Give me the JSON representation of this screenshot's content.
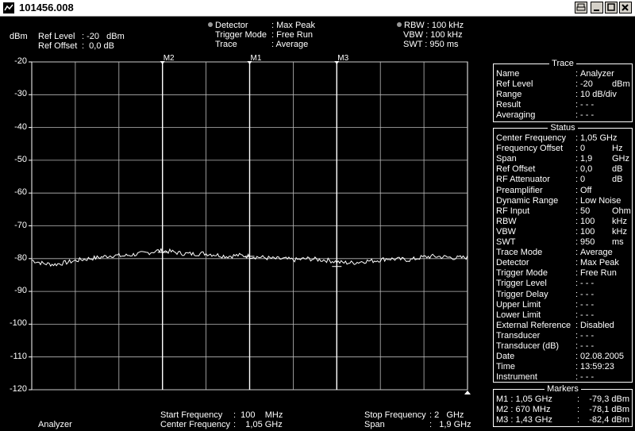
{
  "window": {
    "title": "101456.008"
  },
  "header": {
    "unit": "dBm",
    "ref_level_label": "Ref Level",
    "ref_level_value": ": -20   dBm",
    "ref_offset_label": "Ref Offset",
    "ref_offset_value": ":  0,0 dB",
    "detector_label": "Detector",
    "detector_value": ": Max Peak",
    "trigger_label": "Trigger Mode",
    "trigger_value": ": Free Run",
    "trace_label": "Trace",
    "trace_value": ": Average",
    "rbw": "RBW : 100 kHz",
    "vbw": "VBW : 100 kHz",
    "swt": "SWT : 950 ms"
  },
  "markers_top": [
    "M2",
    "M1",
    "M3"
  ],
  "trace_panel": {
    "title": "Trace",
    "rows": [
      {
        "k": "Name",
        "v": "Analyzer",
        "u": ""
      },
      {
        "k": "Ref Level",
        "v": "-20",
        "u": "dBm"
      },
      {
        "k": "Range",
        "v": "10 dB/div",
        "u": ""
      },
      {
        "k": "Result",
        "v": "- - -",
        "u": ""
      },
      {
        "k": "Averaging",
        "v": "- - -",
        "u": ""
      }
    ]
  },
  "status_panel": {
    "title": "Status",
    "rows": [
      {
        "k": "Center Frequency",
        "v": "1,05 GHz",
        "u": ""
      },
      {
        "k": "Frequency Offset",
        "v": "0",
        "u": "Hz"
      },
      {
        "k": "Span",
        "v": "1,9",
        "u": "GHz"
      },
      {
        "k": "Ref Offset",
        "v": "0,0",
        "u": "dB"
      },
      {
        "k": "RF Attenuator",
        "v": "0",
        "u": "dB"
      },
      {
        "k": "Preamplifier",
        "v": "Off",
        "u": ""
      },
      {
        "k": "Dynamic Range",
        "v": "Low Noise",
        "u": ""
      },
      {
        "k": "RF Input",
        "v": "50",
        "u": "Ohm"
      },
      {
        "k": "RBW",
        "v": "100",
        "u": "kHz"
      },
      {
        "k": "VBW",
        "v": "100",
        "u": "kHz"
      },
      {
        "k": "SWT",
        "v": "950",
        "u": "ms"
      },
      {
        "k": "Trace Mode",
        "v": "Average",
        "u": ""
      },
      {
        "k": "Detector",
        "v": "Max Peak",
        "u": ""
      },
      {
        "k": "Trigger Mode",
        "v": "Free Run",
        "u": ""
      },
      {
        "k": "Trigger Level",
        "v": "- - -",
        "u": ""
      },
      {
        "k": "Trigger Delay",
        "v": "- - -",
        "u": ""
      },
      {
        "k": "Upper Limit",
        "v": "- - -",
        "u": ""
      },
      {
        "k": "Lower Limit",
        "v": "- - -",
        "u": ""
      },
      {
        "k": "External Reference",
        "v": "Disabled",
        "u": ""
      },
      {
        "k": "Transducer",
        "v": "- - -",
        "u": ""
      },
      {
        "k": "Transducer (dB)",
        "v": "- - -",
        "u": ""
      },
      {
        "k": "Date",
        "v": "02.08.2005",
        "u": ""
      },
      {
        "k": "Time",
        "v": "13:59:23",
        "u": ""
      },
      {
        "k": "Instrument",
        "v": "- - -",
        "u": ""
      }
    ]
  },
  "markers_panel": {
    "title": "Markers",
    "rows": [
      {
        "k": "M1 : 1,05 GHz",
        "v": "-79,3 dBm"
      },
      {
        "k": "M2 :  670 MHz",
        "v": "-78,1 dBm"
      },
      {
        "k": "M3 : 1,43 GHz",
        "v": "-82,4 dBm"
      }
    ]
  },
  "footer": {
    "trace_name": "Analyzer",
    "start_label": "Start Frequency",
    "start_value": ":  100    MHz",
    "center_label": "Center Frequency",
    "center_value": ":    1,05 GHz",
    "stop_label": "Stop Frequency",
    "stop_value": ": 2   GHz",
    "span_label": "Span",
    "span_value": ":   1,9 GHz"
  },
  "chart_data": {
    "type": "line",
    "ylabel": "dBm",
    "ylim": [
      -120,
      -20
    ],
    "yticks": [
      -20,
      -30,
      -40,
      -50,
      -60,
      -70,
      -80,
      -90,
      -100,
      -110,
      -120
    ],
    "xlim_ghz": [
      0.1,
      2.0
    ],
    "grid": true,
    "markers": [
      {
        "name": "M2",
        "x_ghz": 0.67,
        "y": -78.1
      },
      {
        "name": "M1",
        "x_ghz": 1.05,
        "y": -79.3
      },
      {
        "name": "M3",
        "x_ghz": 1.43,
        "y": -82.4
      }
    ],
    "series": [
      {
        "x_ghz": [
          0.1,
          0.15,
          0.2,
          0.25,
          0.3,
          0.35,
          0.4,
          0.45,
          0.5,
          0.55,
          0.6,
          0.65,
          0.7,
          0.75,
          0.8,
          0.85,
          0.9,
          0.95,
          1.0,
          1.05,
          1.1,
          1.15,
          1.2,
          1.25,
          1.3,
          1.35,
          1.4,
          1.45,
          1.5,
          1.55,
          1.6,
          1.65,
          1.7,
          1.75,
          1.8,
          1.85,
          1.9,
          1.95,
          2.0
        ],
        "values": [
          -80.5,
          -81.5,
          -81.8,
          -81.2,
          -80.5,
          -80.0,
          -79.6,
          -79.0,
          -79.2,
          -78.7,
          -78.3,
          -77.6,
          -77.8,
          -78.4,
          -78.6,
          -78.4,
          -78.8,
          -79.3,
          -79.0,
          -79.3,
          -79.6,
          -80.0,
          -80.1,
          -80.4,
          -80.0,
          -80.3,
          -80.6,
          -81.2,
          -81.3,
          -80.8,
          -80.6,
          -80.0,
          -80.2,
          -80.4,
          -79.6,
          -79.3,
          -79.5,
          -79.8,
          -79.6
        ]
      }
    ]
  }
}
